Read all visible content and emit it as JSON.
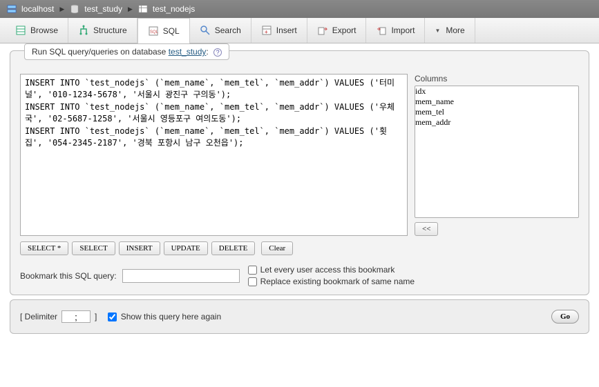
{
  "breadcrumb": {
    "host": "localhost",
    "db": "test_study",
    "table": "test_nodejs"
  },
  "tabs": {
    "browse": "Browse",
    "structure": "Structure",
    "sql": "SQL",
    "search": "Search",
    "insert": "Insert",
    "export": "Export",
    "import": "Import",
    "more": "More"
  },
  "panel": {
    "title_prefix": "Run SQL query/queries on database ",
    "title_db": "test_study",
    "title_suffix": ":",
    "sql_text": "INSERT INTO `test_nodejs` (`mem_name`, `mem_tel`, `mem_addr`) VALUES ('터미널', '010-1234-5678', '서울시 광진구 구의동');\nINSERT INTO `test_nodejs` (`mem_name`, `mem_tel`, `mem_addr`) VALUES ('우체국', '02-5687-1258', '서울시 영등포구 여의도동');\nINSERT INTO `test_nodejs` (`mem_name`, `mem_tel`, `mem_addr`) VALUES ('횟집', '054-2345-2187', '경북 포항시 남구 오천읍');",
    "columns_label": "Columns",
    "columns": [
      "idx",
      "mem_name",
      "mem_tel",
      "mem_addr"
    ],
    "btn_select_star": "SELECT *",
    "btn_select": "SELECT",
    "btn_insert": "INSERT",
    "btn_update": "UPDATE",
    "btn_delete": "DELETE",
    "btn_clear": "Clear",
    "btn_add_col": "<<",
    "bookmark_label": "Bookmark this SQL query:",
    "chk_public": "Let every user access this bookmark",
    "chk_replace": "Replace existing bookmark of same name"
  },
  "footer": {
    "delimiter_open": "[ Delimiter",
    "delimiter_value": ";",
    "delimiter_close": "]",
    "show_again": "Show this query here again",
    "go": "Go"
  }
}
